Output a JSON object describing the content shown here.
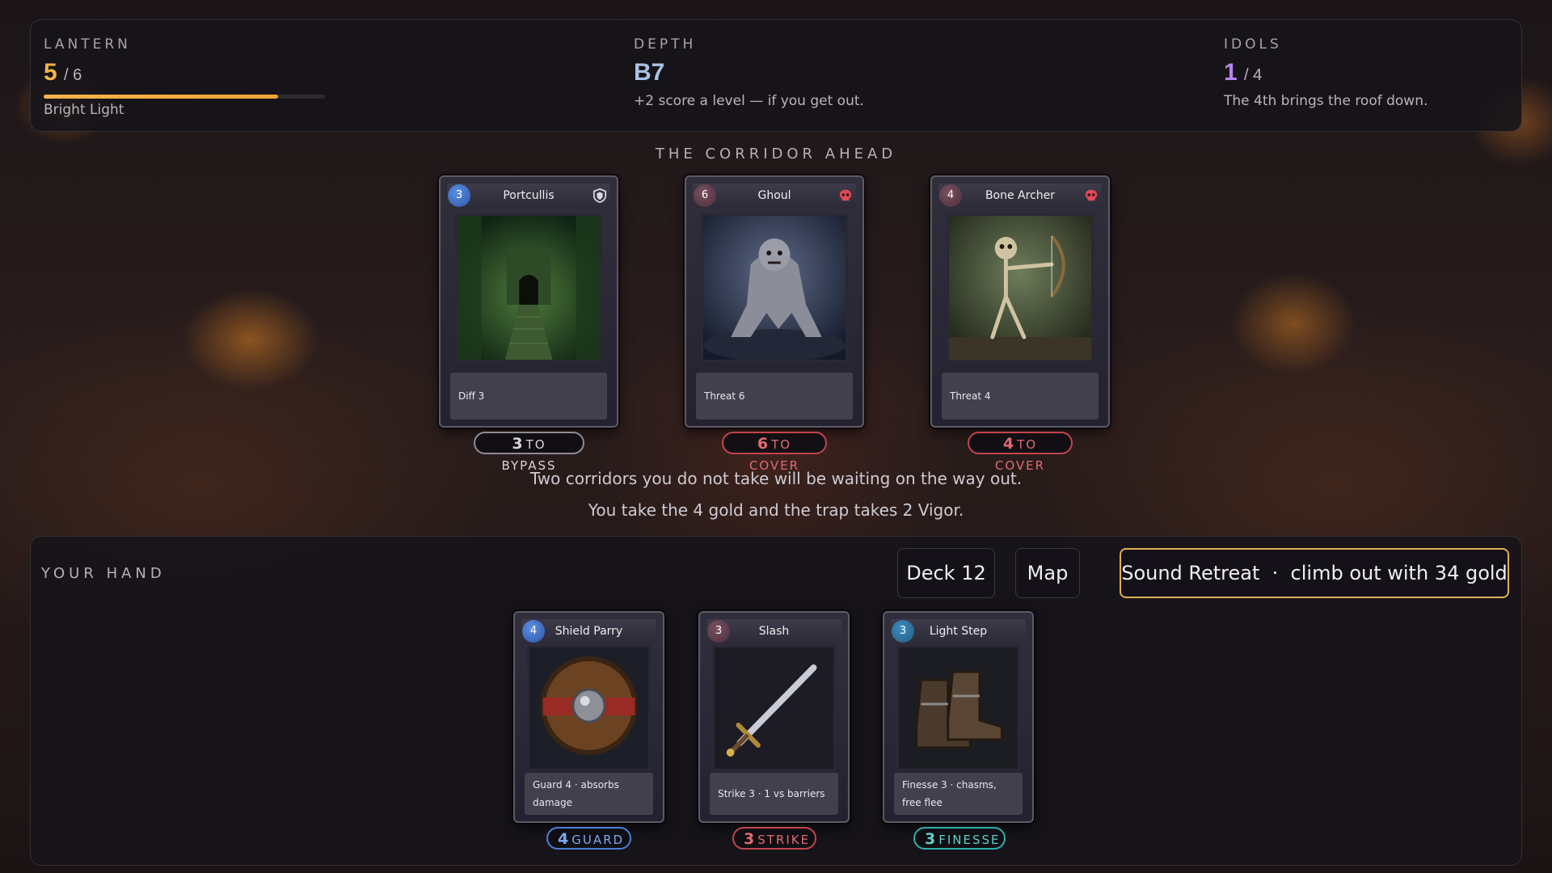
{
  "status": {
    "lantern": {
      "label": "LANTERN",
      "value": "5",
      "max": "/ 6",
      "fill_fraction": 0.8333,
      "note": "Bright Light"
    },
    "depth": {
      "label": "DEPTH",
      "value": "B7",
      "note": "+2 score a level — if you get out."
    },
    "idols": {
      "label": "IDOLS",
      "value": "1",
      "max": "/ 4",
      "note": "The 4th brings the roof down."
    }
  },
  "corridor": {
    "title": "THE CORRIDOR AHEAD",
    "cards": [
      {
        "cost": "3",
        "name": "Portcullis",
        "desc": "Diff 3",
        "icon": "shield-icon",
        "pill_num": "3",
        "pill_text": "TO BYPASS"
      },
      {
        "cost": "6",
        "name": "Ghoul",
        "desc": "Threat 6",
        "icon": "skull-icon",
        "pill_num": "6",
        "pill_text": "TO COVER"
      },
      {
        "cost": "4",
        "name": "Bone Archer",
        "desc": "Threat 4",
        "icon": "skull-icon",
        "pill_num": "4",
        "pill_text": "TO COVER"
      }
    ],
    "message_1": "Two corridors you do not take will be waiting on the way out.",
    "message_2": "You take the 4 gold and the trap takes 2 Vigor."
  },
  "hand": {
    "title": "YOUR HAND",
    "deck_label": "Deck 12",
    "map_label": "Map",
    "retreat_label": "Sound Retreat  ·  climb out with 34 gold",
    "cards": [
      {
        "cost": "4",
        "name": "Shield Parry",
        "desc": "Guard 4 · absorbs damage",
        "pill_num": "4",
        "pill_text": "GUARD"
      },
      {
        "cost": "3",
        "name": "Slash",
        "desc": "Strike 3 · 1 vs barriers",
        "pill_num": "3",
        "pill_text": "STRIKE"
      },
      {
        "cost": "3",
        "name": "Light Step",
        "desc": "Finesse 3 · chasms, free flee",
        "pill_num": "3",
        "pill_text": "FINESSE"
      }
    ]
  },
  "colors": {
    "lantern": "#f3b44a",
    "depth": "#a9c3e6",
    "idols": "#b486f0",
    "accent_gold": "#e0b055"
  }
}
